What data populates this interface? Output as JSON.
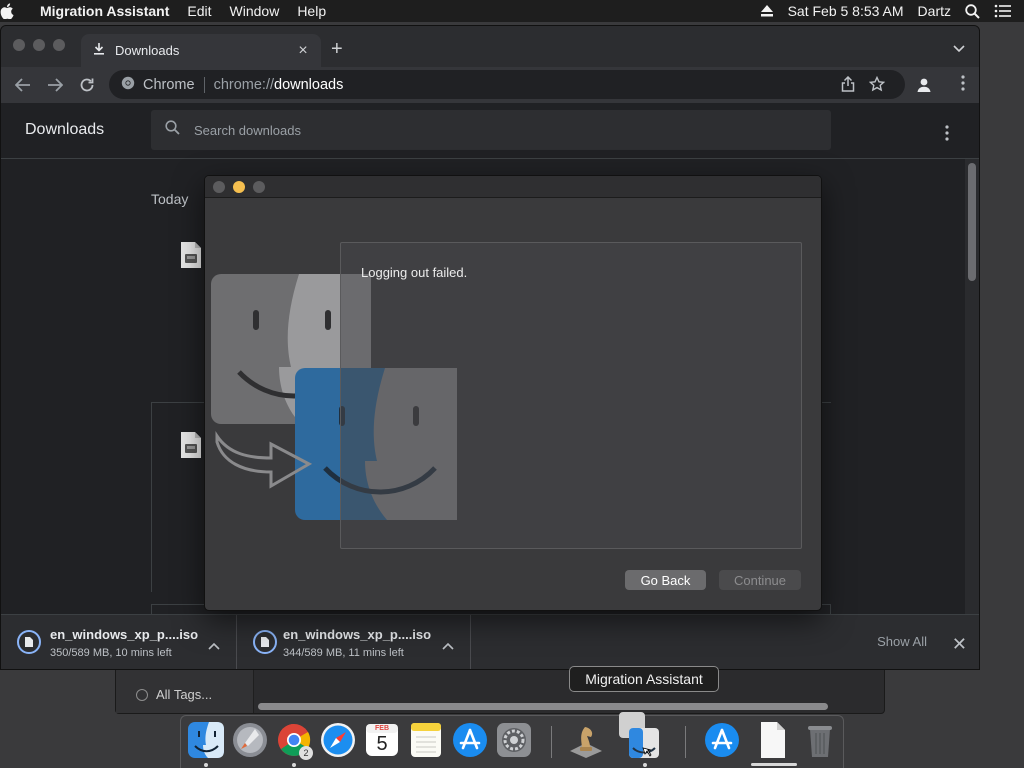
{
  "menubar": {
    "app_name": "Migration Assistant",
    "menus": [
      "Edit",
      "Window",
      "Help"
    ],
    "datetime": "Sat Feb 5  8:53 AM",
    "user": "Dartz"
  },
  "chrome": {
    "tab_title": "Downloads",
    "omnibox_chip": "Chrome",
    "url_scheme": "chrome://",
    "url_host": "downloads",
    "page_title": "Downloads",
    "search_placeholder": "Search downloads",
    "section_today": "Today",
    "shelf": {
      "items": [
        {
          "name": "en_windows_xp_p....iso",
          "status": "350/589 MB, 10 mins left",
          "progress": 0.594
        },
        {
          "name": "en_windows_xp_p....iso",
          "status": "344/589 MB, 11 mins left",
          "progress": 0.584
        }
      ],
      "show_all": "Show All"
    }
  },
  "finder": {
    "all_tags": "All Tags..."
  },
  "migration_assistant": {
    "message": "Logging out failed.",
    "go_back": "Go Back",
    "continue": "Continue"
  },
  "dock": {
    "tooltip": "Migration Assistant",
    "calendar_month": "FEB",
    "calendar_day": "5",
    "chrome_badge": "2"
  },
  "colors": {
    "chrome_bg": "#202124",
    "accent_blue": "#8ab4f8",
    "traffic_minimize": "#f5bf4f"
  }
}
